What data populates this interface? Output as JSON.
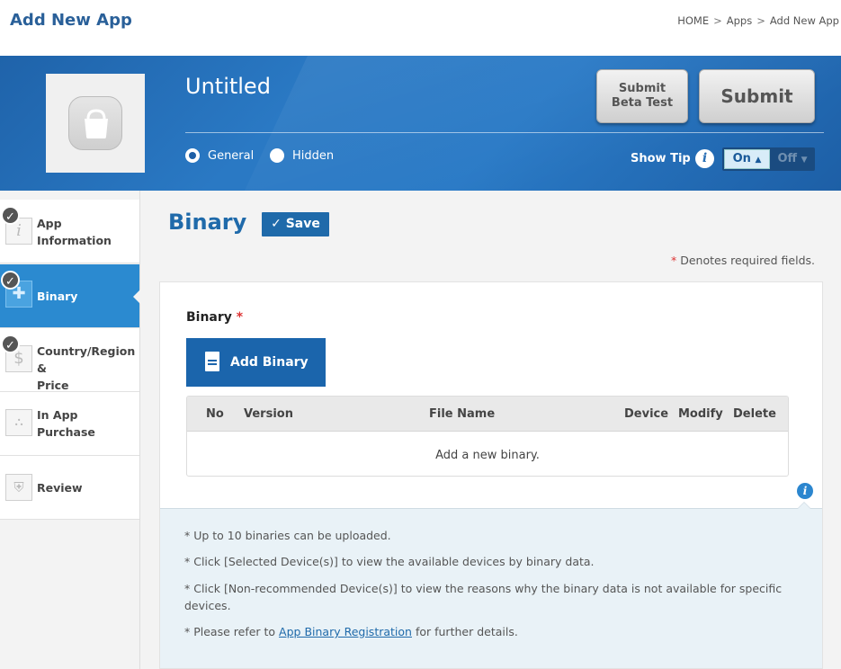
{
  "header": {
    "title": "Add New App",
    "breadcrumb": [
      "HOME",
      "Apps",
      "Add New App"
    ],
    "separator": ">"
  },
  "banner": {
    "app_name": "Untitled",
    "app_icon": "shopping-bag-icon",
    "visibility_options": [
      {
        "label": "General",
        "selected": true
      },
      {
        "label": "Hidden",
        "selected": false
      }
    ],
    "submit_beta_line1": "Submit",
    "submit_beta_line2": "Beta Test",
    "submit_label": "Submit",
    "show_tip_label": "Show Tip",
    "toggle_on": "On",
    "toggle_off": "Off",
    "accent_color": "#1f63aa"
  },
  "sidebar": {
    "items": [
      {
        "line1": "App",
        "line2": "Information",
        "icon": "info-icon",
        "completed": true,
        "active": false
      },
      {
        "line1": "Binary",
        "line2": "",
        "icon": "binary-icon",
        "completed": true,
        "active": true
      },
      {
        "line1": "Country/Region &",
        "line2": "Price",
        "icon": "dollar-icon",
        "completed": true,
        "active": false
      },
      {
        "line1": "In App",
        "line2": "Purchase",
        "icon": "in-app-icon",
        "completed": false,
        "active": false
      },
      {
        "line1": "Review",
        "line2": "",
        "icon": "shield-icon",
        "completed": false,
        "active": false
      }
    ]
  },
  "main": {
    "section_title": "Binary",
    "save_label": "Save",
    "required_asterisk": "*",
    "required_note": "Denotes required fields.",
    "binary_label": "Binary",
    "add_binary_label": "Add Binary",
    "table": {
      "columns": [
        "No",
        "Version",
        "File Name",
        "Device",
        "Modify",
        "Delete"
      ],
      "empty_message": "Add a new binary."
    },
    "tips": [
      "* Up to 10 binaries can be uploaded.",
      "* Click [Selected Device(s)] to view the available devices by binary data.",
      "* Click [Non-recommended Device(s)] to view the reasons why the binary data is not available for specific devices."
    ],
    "tip_refer_prefix": "* Please refer to ",
    "tip_refer_link": "App Binary Registration",
    "tip_refer_suffix": " for further details."
  }
}
